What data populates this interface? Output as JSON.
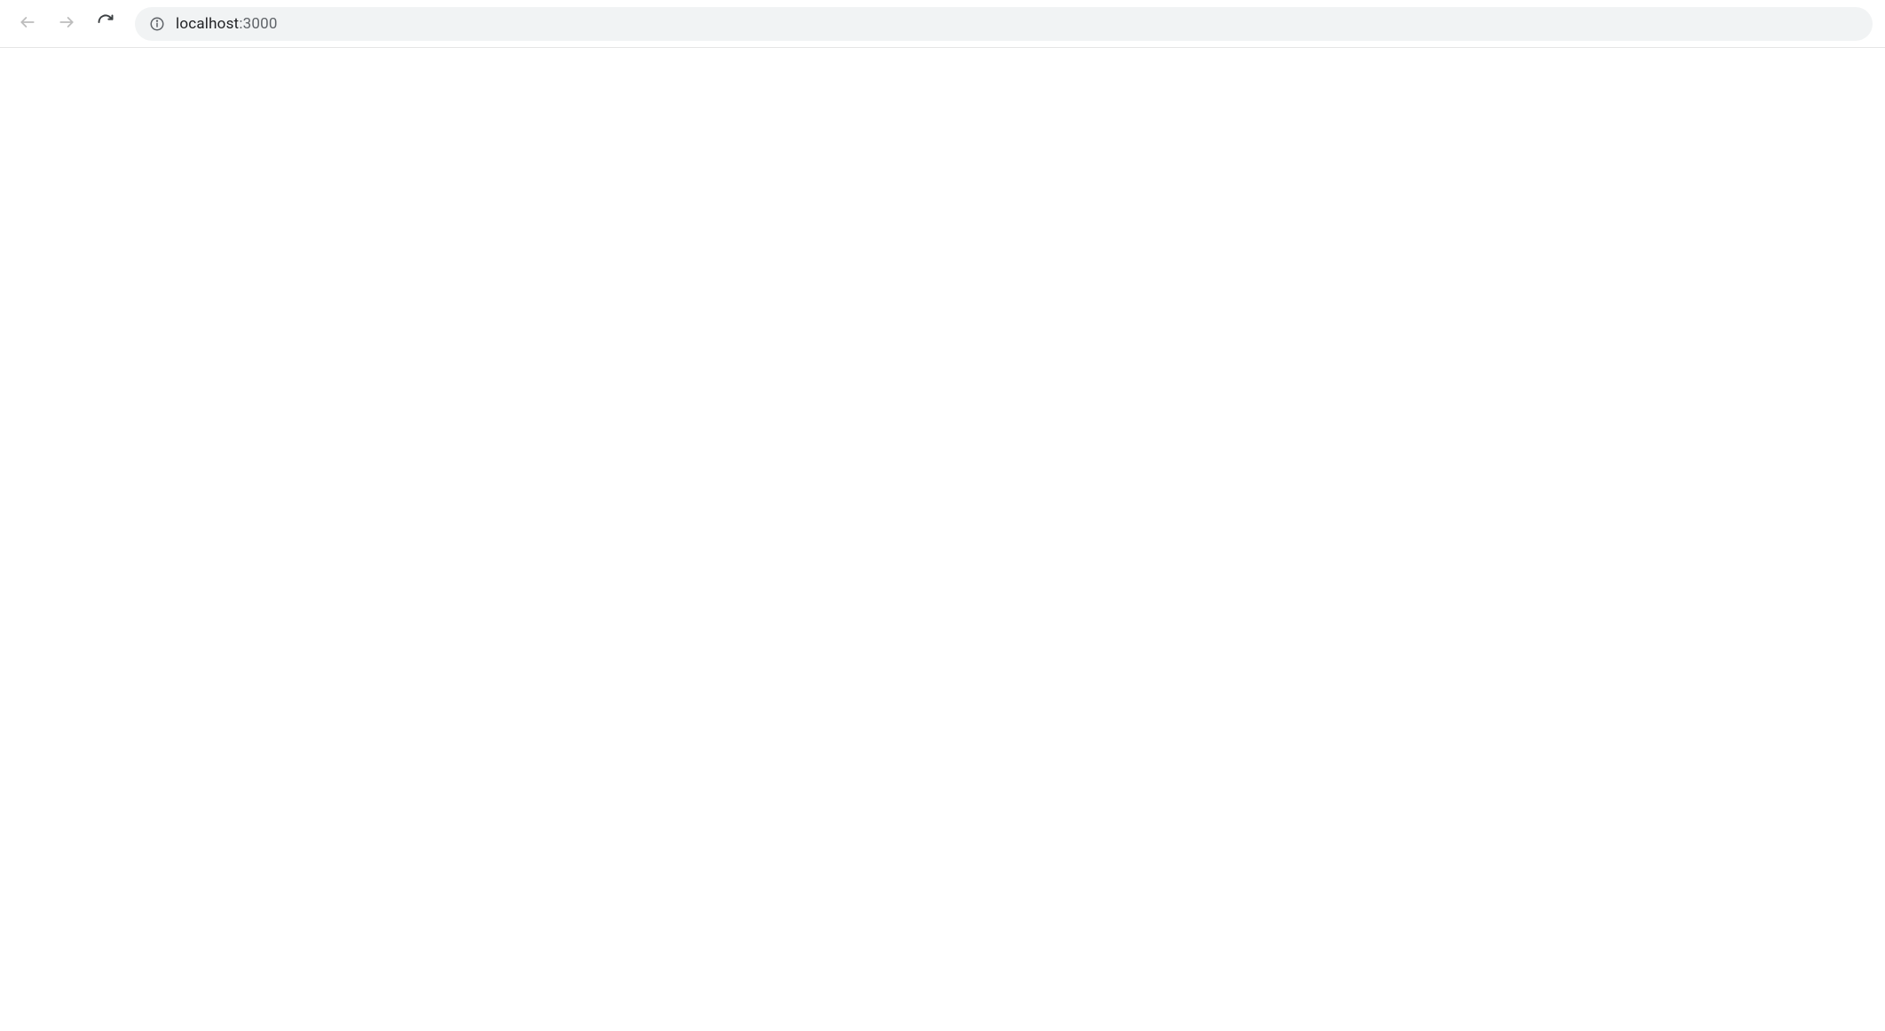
{
  "browser": {
    "navigation": {
      "back_enabled": false,
      "forward_enabled": false
    },
    "address": {
      "host": "localhost",
      "port_separator": ":",
      "port": "3000"
    }
  }
}
